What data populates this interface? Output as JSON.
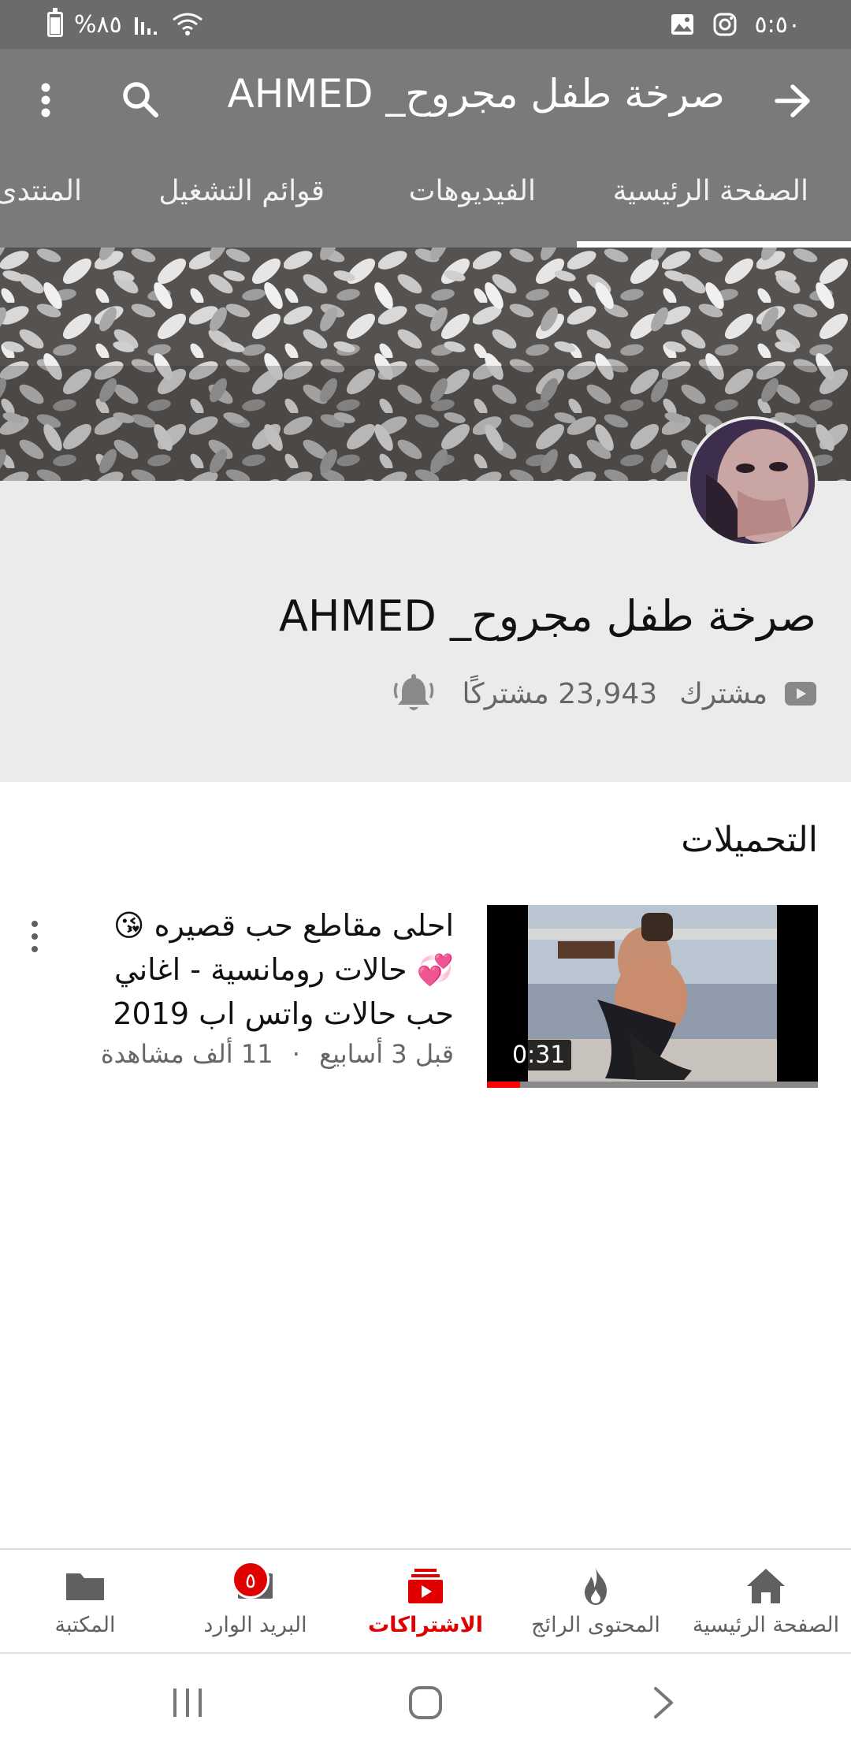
{
  "status_bar": {
    "battery_label": "%٨٥",
    "time": "٥:٥٠"
  },
  "app_bar": {
    "title": "صرخة طفل مجروح_ AHMED",
    "back_icon": "arrow-right-icon",
    "search_icon": "search-icon",
    "menu_icon": "more-vert-icon"
  },
  "tabs": [
    {
      "label": "الصفحة الرئيسية",
      "active": true
    },
    {
      "label": "الفيديوهات",
      "active": false
    },
    {
      "label": "قوائم التشغيل",
      "active": false
    },
    {
      "label": "المنتدى",
      "active": false
    }
  ],
  "channel": {
    "name": "صرخة طفل مجروح_ AHMED",
    "subscribed_label": "مشترك",
    "subscribers": "23,943 مشتركًا",
    "bell_icon": "bell-icon"
  },
  "uploads": {
    "heading": "التحميلات",
    "videos": [
      {
        "title": "احلى مقاطع حب قصيره 😘💞 حالات رومانسية - اغاني حب حالات واتس اب 2019",
        "age": "قبل 3 أسابيع",
        "views": "11 ألف مشاهدة",
        "separator": "·",
        "duration": "0:31",
        "progress": 0.1
      }
    ]
  },
  "bottom_nav": [
    {
      "label": "الصفحة الرئيسية",
      "icon": "home-icon",
      "active": false
    },
    {
      "label": "المحتوى الرائج",
      "icon": "fire-icon",
      "active": false
    },
    {
      "label": "الاشتراكات",
      "icon": "subscriptions-icon",
      "active": true
    },
    {
      "label": "البريد الوارد",
      "icon": "inbox-icon",
      "active": false,
      "badge": "٥"
    },
    {
      "label": "المكتبة",
      "icon": "folder-icon",
      "active": false
    }
  ],
  "colors": {
    "accent": "#e00000",
    "app_bar": "#7a7a7a",
    "status_bar": "#6b6b6b"
  }
}
